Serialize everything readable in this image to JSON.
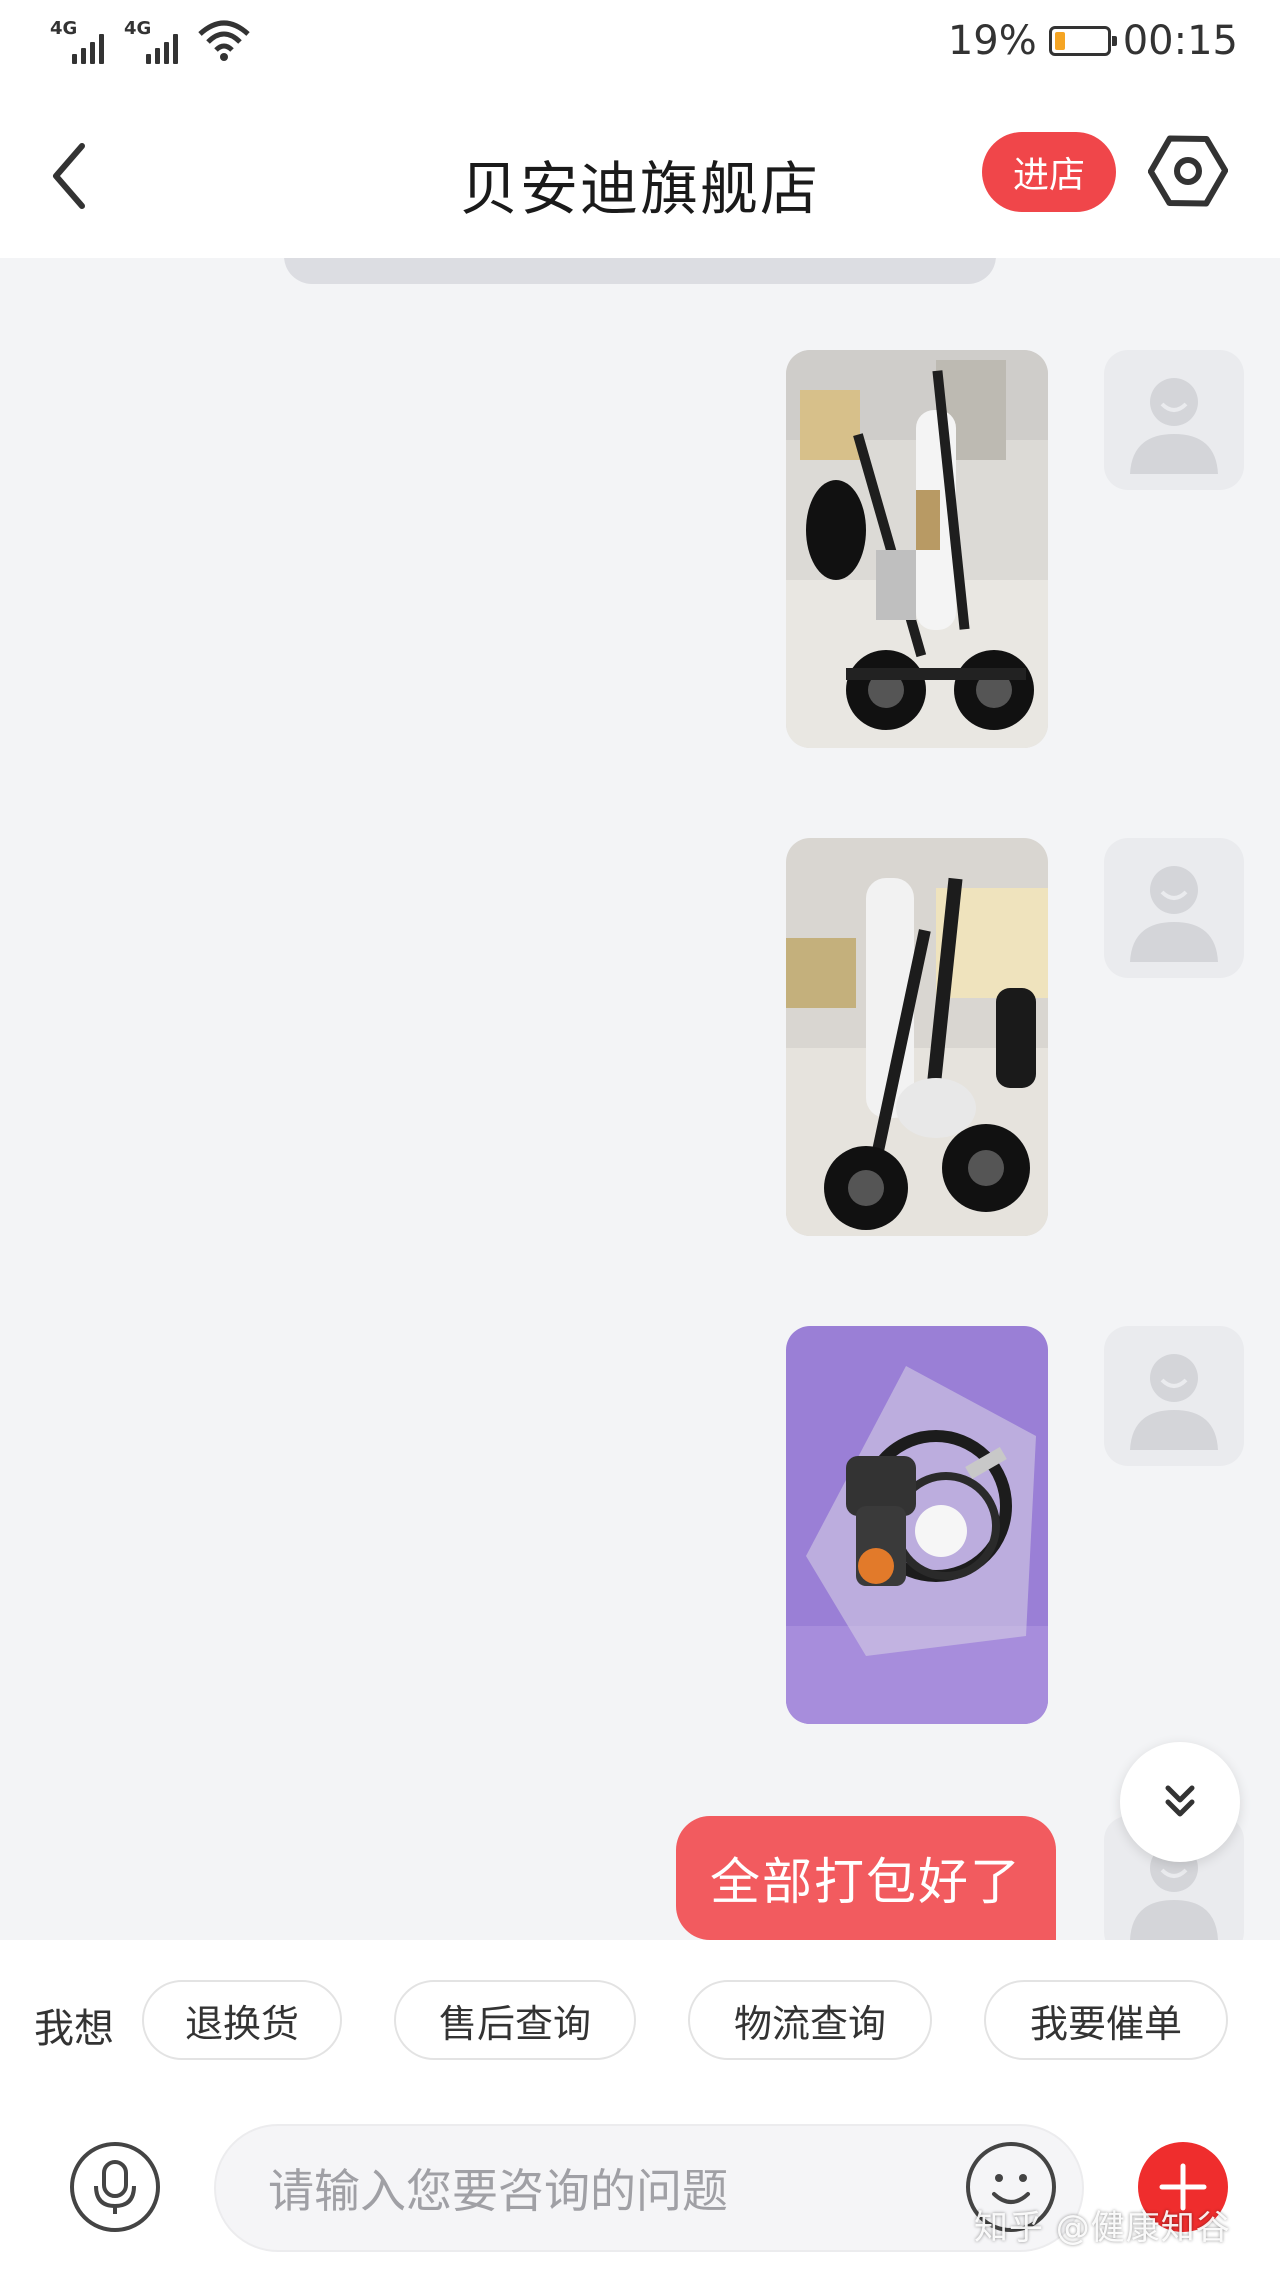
{
  "status_bar": {
    "signal_1_label": "4G",
    "signal_2_label": "4G",
    "battery_percent": "19%",
    "battery_level": 0.19,
    "time": "00:15"
  },
  "header": {
    "title": "贝安迪旗舰店",
    "store_button": "进店"
  },
  "messages": [
    {
      "type": "image",
      "icon": "folded-scooter-photo",
      "sender": "me"
    },
    {
      "type": "image",
      "icon": "folded-scooter-photo",
      "sender": "me"
    },
    {
      "type": "image",
      "icon": "key-and-charger-in-bag-photo",
      "sender": "me"
    },
    {
      "type": "text",
      "text": "全部打包好了",
      "sender": "me"
    }
  ],
  "quick_actions": {
    "label": "我想",
    "chips": [
      "退换货",
      "售后查询",
      "物流查询",
      "我要催单"
    ]
  },
  "input": {
    "placeholder": "请输入您要咨询的问题"
  },
  "watermark": "知乎 @健康知谷",
  "colors": {
    "accent": "#f0464a",
    "bubble": "#f25b5f",
    "chat_bg": "#f3f4f6"
  }
}
